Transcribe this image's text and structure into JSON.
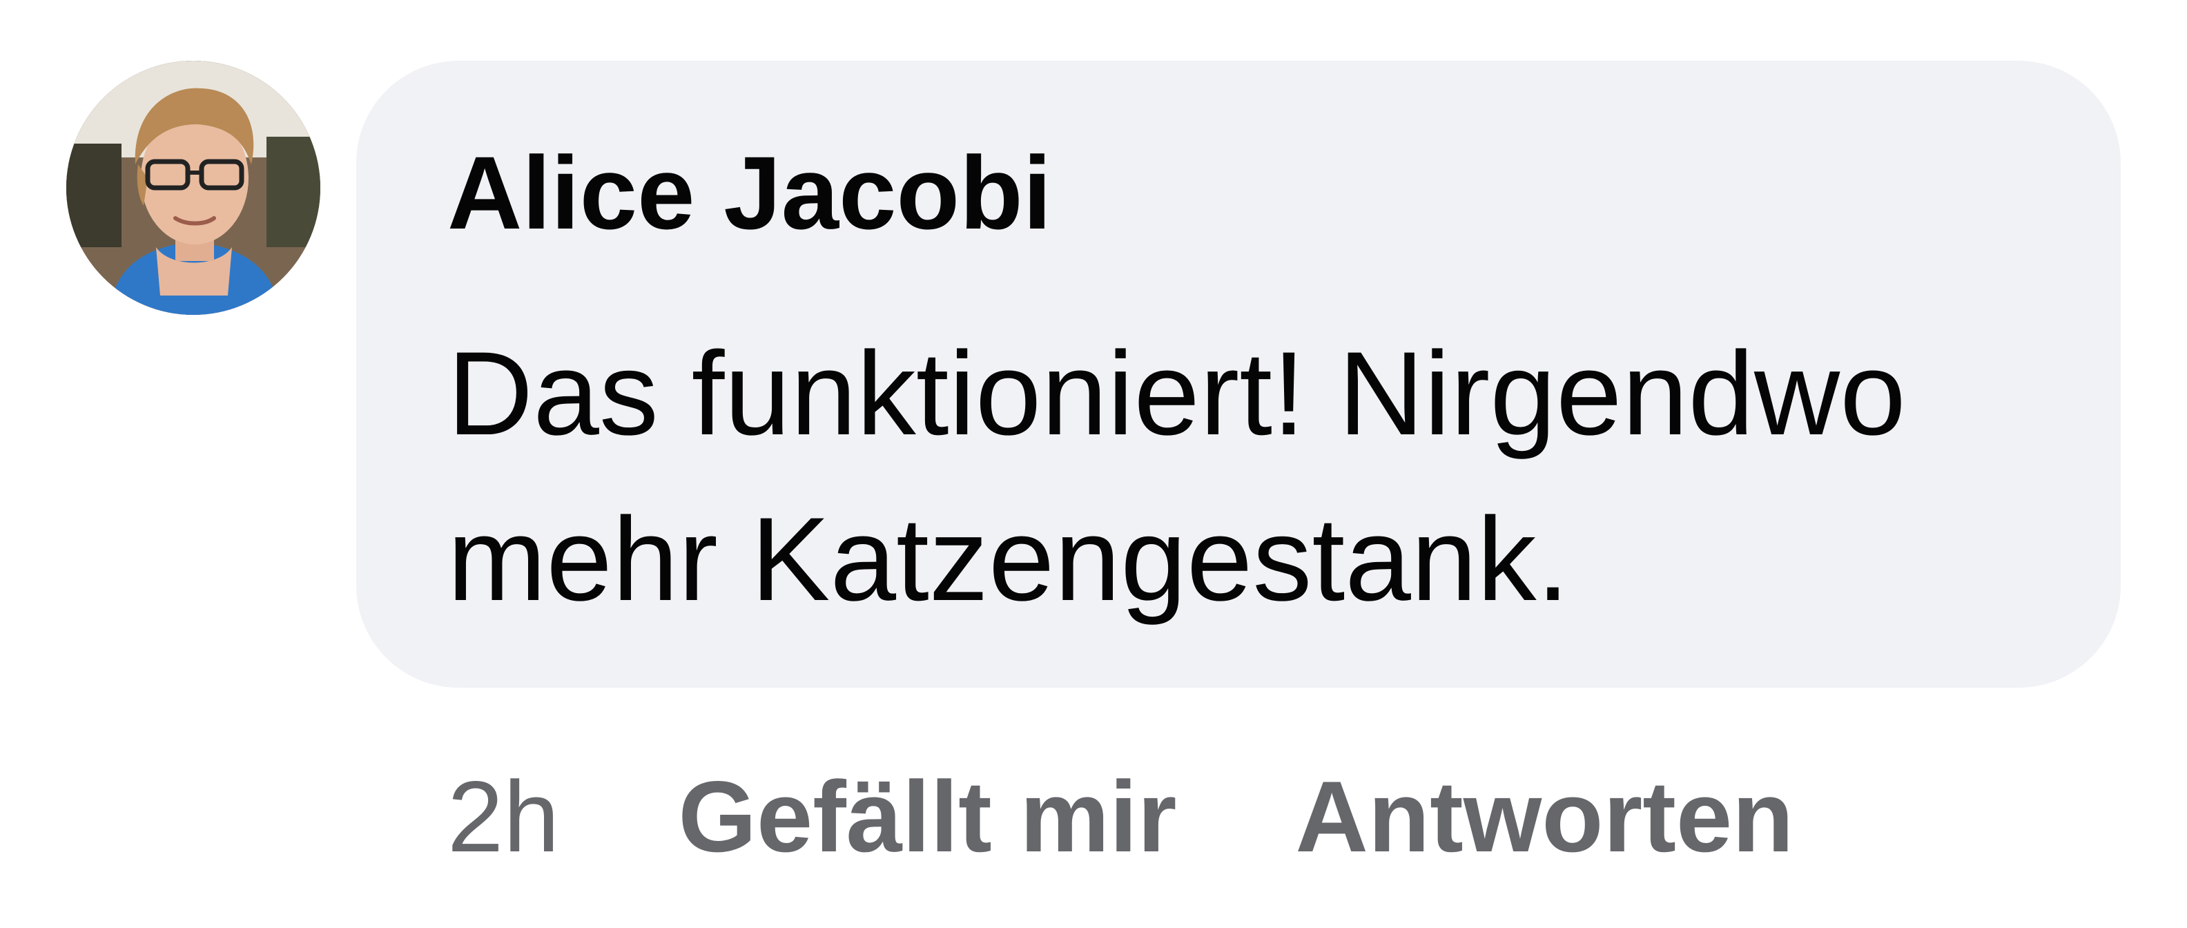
{
  "comment": {
    "author": "Alice Jacobi",
    "text": "Das funktioniert! Nirgendwo mehr Katzengestank.",
    "timestamp": "2h",
    "like_label": "Gefällt mir",
    "reply_label": "Antworten"
  },
  "colors": {
    "bubble_background": "#f0f2f5",
    "text": "#050505",
    "secondary_text": "#65676b"
  }
}
